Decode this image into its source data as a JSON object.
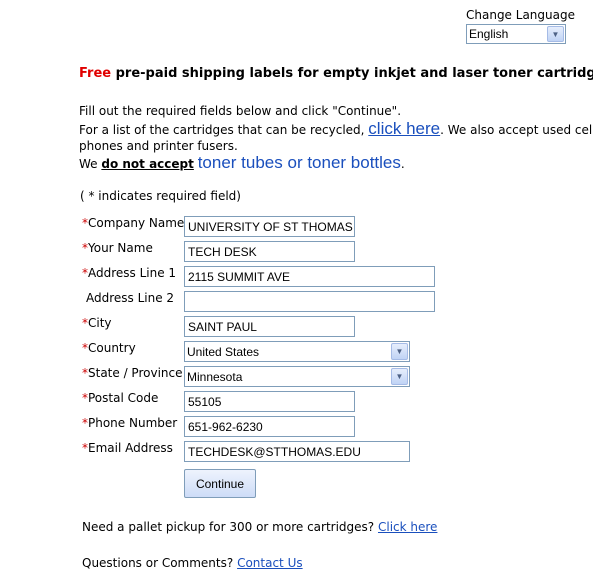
{
  "language": {
    "label": "Change Language",
    "selected": "English"
  },
  "intro": {
    "free": "Free",
    "headline_rest": " pre-paid shipping labels for empty inkjet and laser toner cartridges",
    "line1": "Fill out the required fields below and click \"Continue\".",
    "line2_pre": "For a list of the cartridges that can be recycled, ",
    "line2_link": "click here",
    "line2_post": ". We also accept used cell",
    "line3": "phones and printer fusers.",
    "line4_pre": "We ",
    "line4_bold": "do not accept",
    "line4_link": "toner tubes or toner bottles",
    "line4_post": ".",
    "required_note": "( * indicates required field)"
  },
  "form": {
    "asterisk": "*",
    "fields": [
      {
        "label": "Company Name",
        "value": "UNIVERSITY OF ST THOMAS",
        "required": true
      },
      {
        "label": "Your Name",
        "value": "TECH DESK",
        "required": true
      },
      {
        "label": "Address Line 1",
        "value": "2115 SUMMIT AVE",
        "required": true
      },
      {
        "label": "Address Line 2",
        "value": "",
        "required": false
      },
      {
        "label": "City",
        "value": "SAINT PAUL",
        "required": true
      },
      {
        "label": "Country",
        "value": "United States",
        "required": true
      },
      {
        "label": "State / Province",
        "value": "Minnesota",
        "required": true
      },
      {
        "label": "Postal Code",
        "value": "55105",
        "required": true
      },
      {
        "label": "Phone Number",
        "value": "651-962-6230",
        "required": true
      },
      {
        "label": "Email Address",
        "value": "TECHDESK@STTHOMAS.EDU",
        "required": true
      }
    ],
    "continue_label": "Continue"
  },
  "footer": {
    "pallet_text": "Need a pallet pickup for 300 or more cartridges? ",
    "pallet_link": "Click here",
    "questions_text": "Questions or Comments? ",
    "contact_link": "Contact Us"
  }
}
